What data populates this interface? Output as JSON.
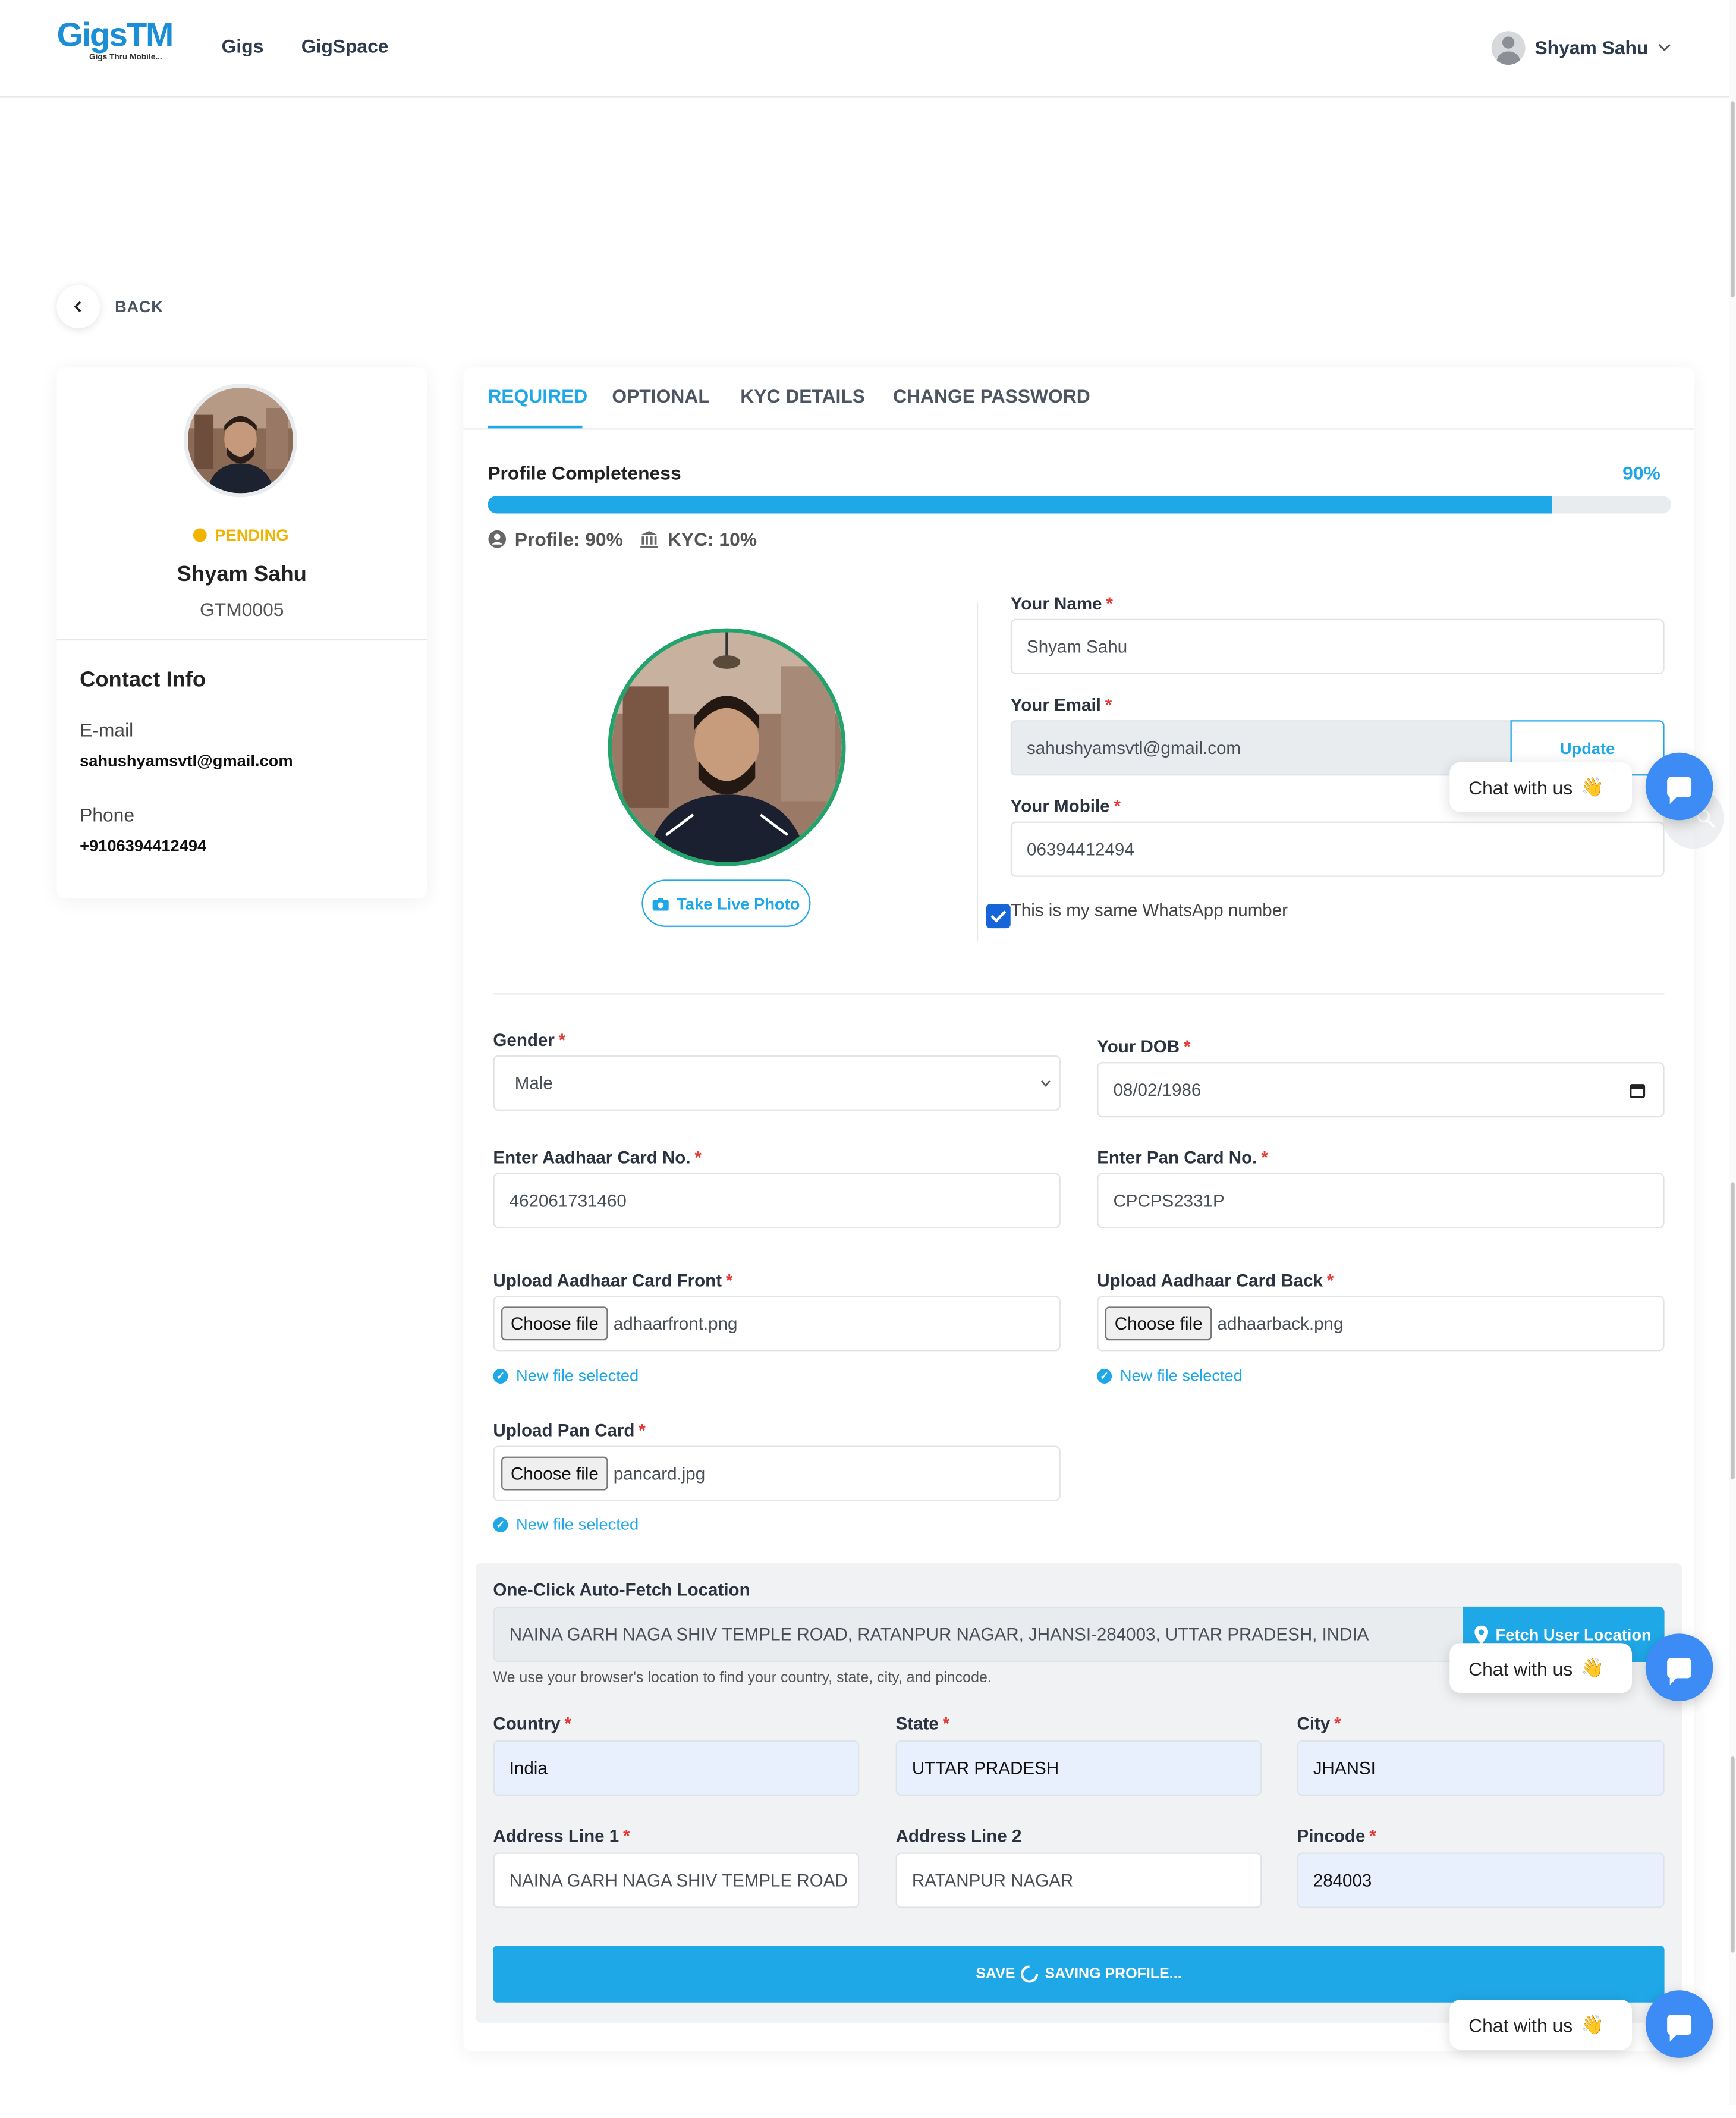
{
  "header": {
    "logo_text": "GigsTM",
    "logo_subtitle": "Gigs Thru Mobile...",
    "nav": [
      "Gigs",
      "GigSpace"
    ],
    "user_name": "Shyam Sahu"
  },
  "back_label": "BACK",
  "profile_card": {
    "status": "PENDING",
    "name": "Shyam Sahu",
    "id": "GTM0005",
    "contact_title": "Contact Info",
    "email_label": "E-mail",
    "email": "sahushyamsvtl@gmail.com",
    "phone_label": "Phone",
    "phone": "+9106394412494"
  },
  "tabs": [
    "REQUIRED",
    "OPTIONAL",
    "KYC DETAILS",
    "CHANGE PASSWORD"
  ],
  "completeness": {
    "title": "Profile Completeness",
    "percent_label": "90%",
    "progress": 0.9,
    "profile_label": "Profile: 90%",
    "kyc_label": "KYC: 10%"
  },
  "photo": {
    "take_live_photo": "Take Live Photo"
  },
  "form": {
    "name_label": "Your Name",
    "name_value": "Shyam Sahu",
    "email_label": "Your Email",
    "email_value": "sahushyamsvtl@gmail.com",
    "update_label": "Update",
    "mobile_label": "Your Mobile",
    "mobile_value": "06394412494",
    "whatsapp_label": "This is my same WhatsApp number",
    "gender_label": "Gender",
    "gender_value": "Male",
    "dob_label": "Your DOB",
    "dob_value": "08/02/1986",
    "aadhaar_label": "Enter Aadhaar Card No.",
    "aadhaar_value": "462061731460",
    "pan_label": "Enter Pan Card No.",
    "pan_value": "CPCPS2331P",
    "aadhaar_front_label": "Upload Aadhaar Card Front",
    "aadhaar_front_file": "adhaarfront.png",
    "aadhaar_back_label": "Upload Aadhaar Card Back",
    "aadhaar_back_file": "adhaarback.png",
    "pan_upload_label": "Upload Pan Card",
    "pan_upload_file": "pancard.jpg",
    "choose_file": "Choose file",
    "new_file_selected": "New file selected"
  },
  "location": {
    "title": "One-Click Auto-Fetch Location",
    "address": "NAINA GARH NAGA SHIV TEMPLE ROAD, RATANPUR NAGAR, JHANSI-284003, UTTAR PRADESH, INDIA",
    "fetch_button": "Fetch User Location",
    "hint": "We use your browser's location to find your country, state, city, and pincode.",
    "country_label": "Country",
    "country_value": "India",
    "state_label": "State",
    "state_value": "UTTAR PRADESH",
    "city_label": "City",
    "city_value": "JHANSI",
    "address1_label": "Address Line 1",
    "address1_value": "NAINA GARH NAGA SHIV TEMPLE ROAD",
    "address2_label": "Address Line 2",
    "address2_value": "RATANPUR NAGAR",
    "pincode_label": "Pincode",
    "pincode_value": "284003"
  },
  "save_button": {
    "save": "SAVE",
    "saving": "SAVING PROFILE..."
  },
  "chat": {
    "label": "Chat with us",
    "emoji": "👋"
  },
  "colors": {
    "accent": "#1fa8e8",
    "pending": "#f0b400",
    "chat": "#3d8cf5",
    "photo_ring": "#22a36b"
  }
}
